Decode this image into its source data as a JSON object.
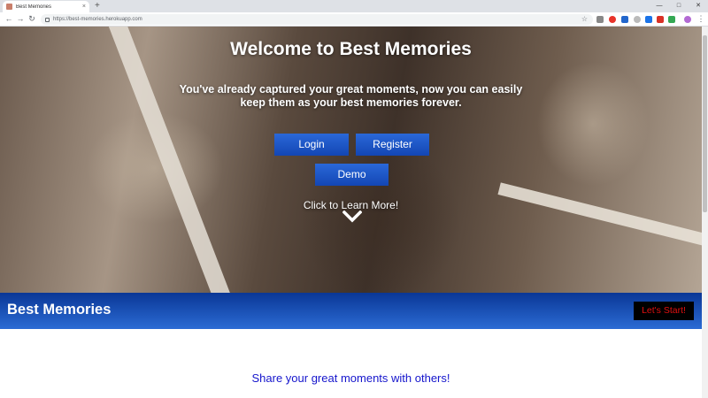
{
  "browser": {
    "tab_title": "Best Memories",
    "tab_close": "×",
    "new_tab": "+",
    "url": "https://best-memories.herokuapp.com",
    "back_icon": "arrow-left-icon",
    "forward_icon": "arrow-right-icon",
    "reload_icon": "reload-icon",
    "bookmark_icon": "star-icon"
  },
  "hero": {
    "title": "Welcome to Best Memories",
    "subtitle": "You've already captured your great moments, now you can easily keep them as your best memories forever.",
    "login_label": "Login",
    "register_label": "Register",
    "demo_label": "Demo",
    "learn_more": "Click to Learn More!",
    "chevron_icon": "chevron-down-icon"
  },
  "navbar": {
    "brand": "Best Memories",
    "cta_label": "Let's Start!"
  },
  "section": {
    "heading": "Share your great moments with others!"
  },
  "colors": {
    "accent_blue": "#1a4fc0",
    "cta_text": "#e01010",
    "heading_blue": "#1515cc"
  }
}
